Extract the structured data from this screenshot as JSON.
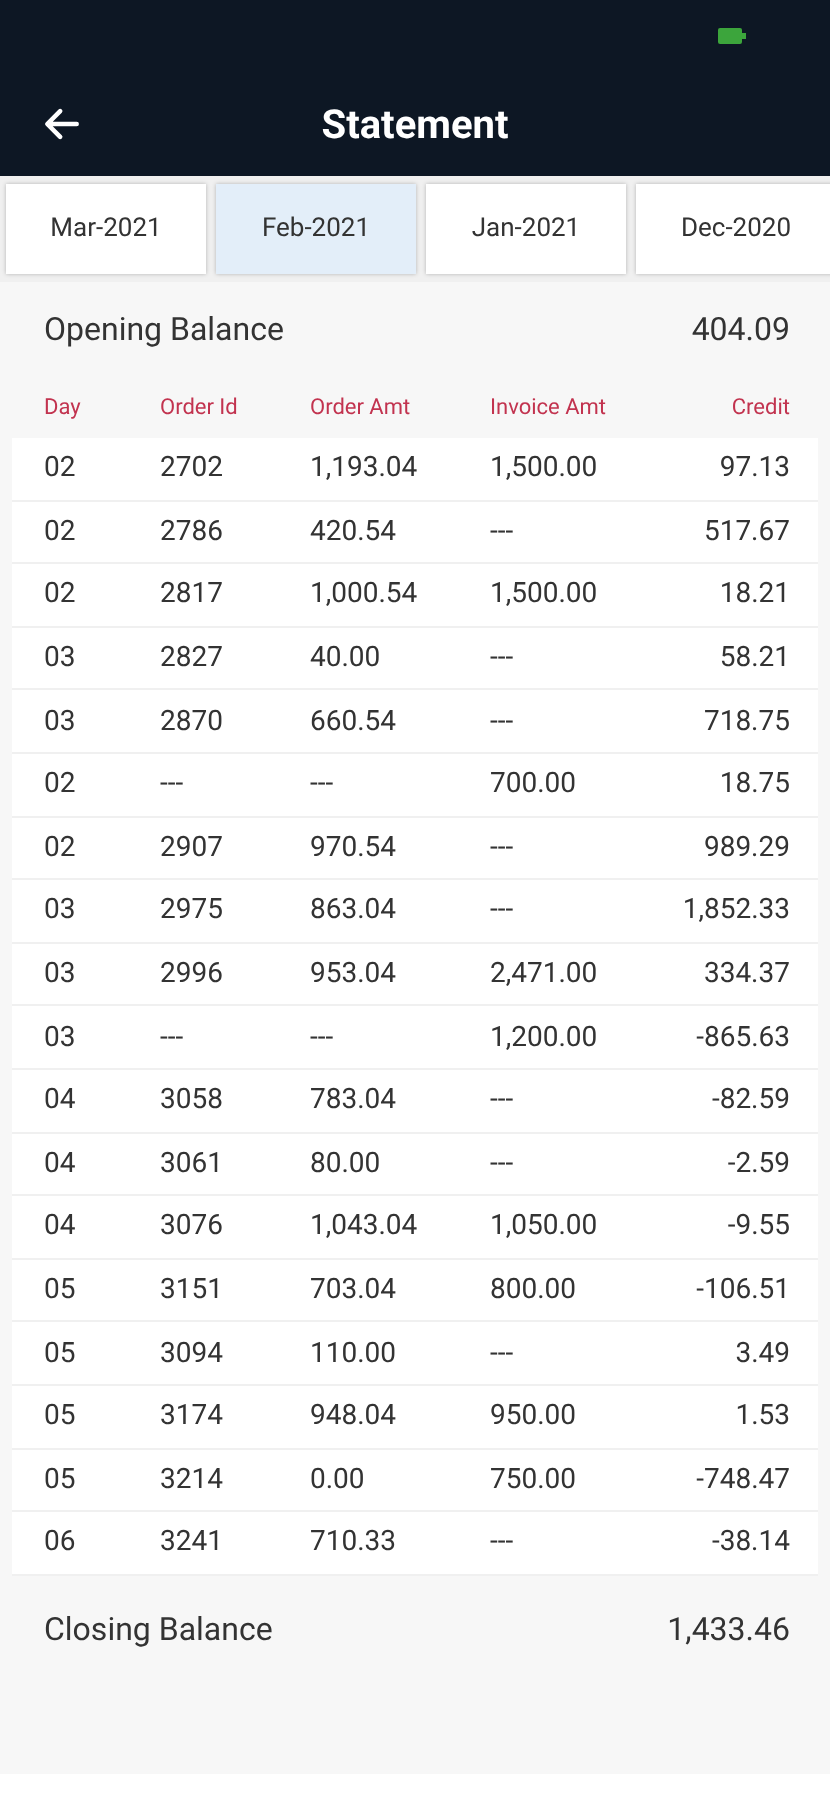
{
  "app_bar": {
    "title": "Statement"
  },
  "tabs": [
    {
      "label": "Mar-2021",
      "selected": false
    },
    {
      "label": "Feb-2021",
      "selected": true
    },
    {
      "label": "Jan-2021",
      "selected": false
    },
    {
      "label": "Dec-2020",
      "selected": false
    }
  ],
  "opening_balance": {
    "label": "Opening Balance",
    "value": "404.09"
  },
  "table": {
    "columns": [
      "Day",
      "Order Id",
      "Order Amt",
      "Invoice Amt",
      "Credit"
    ],
    "rows": [
      [
        "02",
        "2702",
        "1,193.04",
        "1,500.00",
        "97.13"
      ],
      [
        "02",
        "2786",
        "420.54",
        "---",
        "517.67"
      ],
      [
        "02",
        "2817",
        "1,000.54",
        "1,500.00",
        "18.21"
      ],
      [
        "03",
        "2827",
        "40.00",
        "---",
        "58.21"
      ],
      [
        "03",
        "2870",
        "660.54",
        "---",
        "718.75"
      ],
      [
        "02",
        "---",
        "---",
        "700.00",
        "18.75"
      ],
      [
        "02",
        "2907",
        "970.54",
        "---",
        "989.29"
      ],
      [
        "03",
        "2975",
        "863.04",
        "---",
        "1,852.33"
      ],
      [
        "03",
        "2996",
        "953.04",
        "2,471.00",
        "334.37"
      ],
      [
        "03",
        "---",
        "---",
        "1,200.00",
        "-865.63"
      ],
      [
        "04",
        "3058",
        "783.04",
        "---",
        "-82.59"
      ],
      [
        "04",
        "3061",
        "80.00",
        "---",
        "-2.59"
      ],
      [
        "04",
        "3076",
        "1,043.04",
        "1,050.00",
        "-9.55"
      ],
      [
        "05",
        "3151",
        "703.04",
        "800.00",
        "-106.51"
      ],
      [
        "05",
        "3094",
        "110.00",
        "---",
        "3.49"
      ],
      [
        "05",
        "3174",
        "948.04",
        "950.00",
        "1.53"
      ],
      [
        "05",
        "3214",
        "0.00",
        "750.00",
        "-748.47"
      ],
      [
        "06",
        "3241",
        "710.33",
        "---",
        "-38.14"
      ]
    ]
  },
  "closing_balance": {
    "label": "Closing Balance",
    "value": "1,433.46"
  }
}
